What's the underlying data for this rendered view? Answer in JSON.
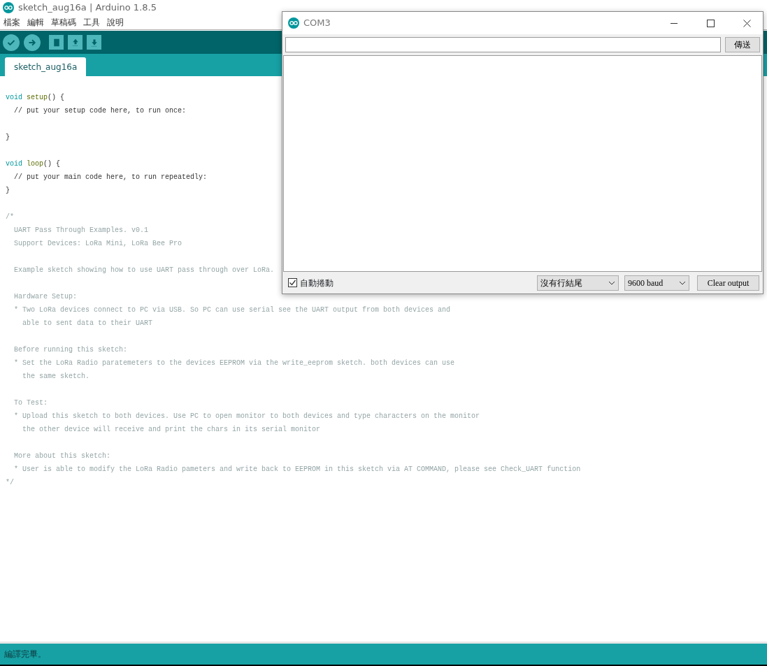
{
  "window": {
    "title": "sketch_aug16a | Arduino 1.8.5"
  },
  "menu": [
    "檔案",
    "編輯",
    "草稿碼",
    "工具",
    "說明"
  ],
  "tabs": [
    {
      "label": "sketch_aug16a",
      "selected": true
    }
  ],
  "editor": {
    "lines": [
      {
        "kind": "code",
        "tokens": [
          {
            "kind": "keyword",
            "text": "void "
          },
          {
            "kind": "function",
            "text": "setup"
          },
          {
            "kind": "plain",
            "text": "() {"
          }
        ]
      },
      {
        "kind": "code",
        "tokens": [
          {
            "kind": "plain",
            "text": "  // put your setup code here, to run once:"
          }
        ]
      },
      {
        "kind": "blank"
      },
      {
        "kind": "code",
        "tokens": [
          {
            "kind": "plain",
            "text": "}"
          }
        ]
      },
      {
        "kind": "blank"
      },
      {
        "kind": "code",
        "tokens": [
          {
            "kind": "keyword",
            "text": "void "
          },
          {
            "kind": "function",
            "text": "loop"
          },
          {
            "kind": "plain",
            "text": "() {"
          }
        ]
      },
      {
        "kind": "code",
        "tokens": [
          {
            "kind": "plain",
            "text": "  // put your main code here, to run repeatedly:"
          }
        ]
      },
      {
        "kind": "code",
        "tokens": [
          {
            "kind": "plain",
            "text": "}"
          }
        ]
      },
      {
        "kind": "blank"
      },
      {
        "kind": "comment",
        "text": "/*"
      },
      {
        "kind": "comment",
        "text": "  UART Pass Through Examples. v0.1"
      },
      {
        "kind": "comment",
        "text": "  Support Devices: LoRa Mini, LoRa Bee Pro"
      },
      {
        "kind": "blank"
      },
      {
        "kind": "comment",
        "text": "  Example sketch showing how to use UART pass through over LoRa."
      },
      {
        "kind": "blank"
      },
      {
        "kind": "comment",
        "text": "  Hardware Setup:"
      },
      {
        "kind": "comment",
        "text": "  * Two LoRa devices connect to PC via USB. So PC can use serial see the UART output from both devices and"
      },
      {
        "kind": "comment",
        "text": "    able to sent data to their UART"
      },
      {
        "kind": "blank"
      },
      {
        "kind": "comment",
        "text": "  Before running this sketch:"
      },
      {
        "kind": "comment",
        "text": "  * Set the LoRa Radio paratemeters to the devices EEPROM via the write_eeprom sketch. both devices can use"
      },
      {
        "kind": "comment",
        "text": "    the same sketch."
      },
      {
        "kind": "blank"
      },
      {
        "kind": "comment",
        "text": "  To Test:"
      },
      {
        "kind": "comment",
        "text": "  * Upload this sketch to both devices. Use PC to open monitor to both devices and type characters on the monitor"
      },
      {
        "kind": "comment",
        "text": "    the other device will receive and print the chars in its serial monitor"
      },
      {
        "kind": "blank"
      },
      {
        "kind": "comment",
        "text": "  More about this sketch:"
      },
      {
        "kind": "comment",
        "text": "  * User is able to modify the LoRa Radio pameters and write back to EEPROM in this sketch via AT COMMAND, please see Check_UART function"
      },
      {
        "kind": "comment",
        "text": "*/"
      }
    ]
  },
  "status_bar": {
    "text": "編譯完畢。"
  },
  "serial_monitor": {
    "title": "COM3",
    "send_button": "傳送",
    "autoscroll": {
      "label": "自動捲動",
      "checked": true
    },
    "line_ending": "沒有行結尾",
    "baud": "9600 baud",
    "clear_button": "Clear output"
  }
}
